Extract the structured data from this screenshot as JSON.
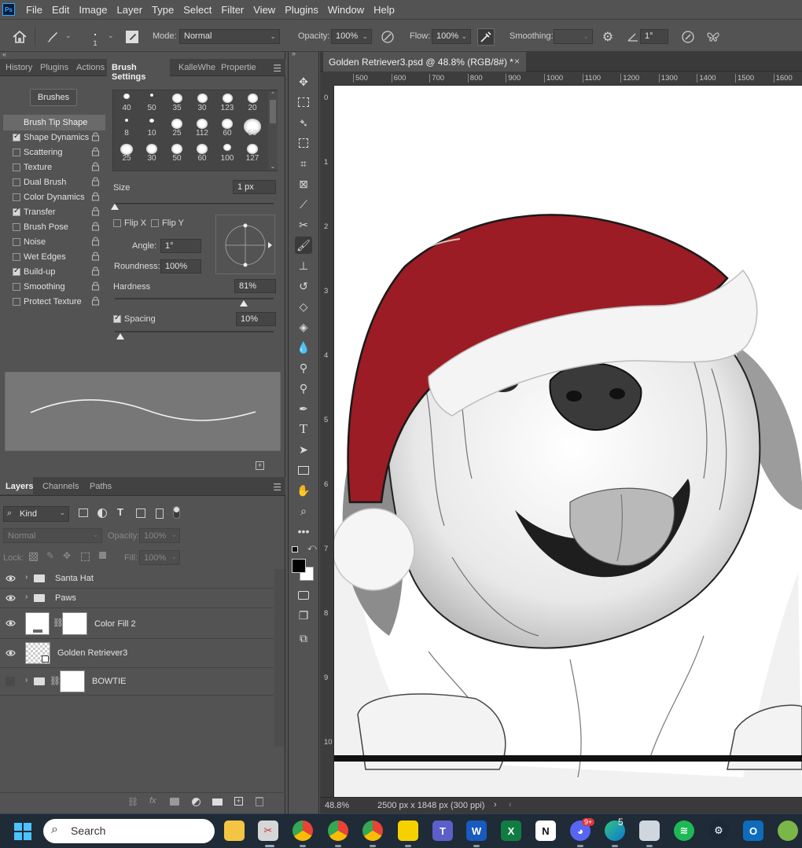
{
  "app": {
    "logo_text": "Ps"
  },
  "menu": [
    "File",
    "Edit",
    "Image",
    "Layer",
    "Type",
    "Select",
    "Filter",
    "View",
    "Plugins",
    "Window",
    "Help"
  ],
  "options": {
    "brush_size_label": "1",
    "mode_label": "Mode:",
    "mode_value": "Normal",
    "opacity_label": "Opacity:",
    "opacity_value": "100%",
    "flow_label": "Flow:",
    "flow_value": "100%",
    "smoothing_label": "Smoothing:",
    "smoothing_value": "",
    "angle_value": "1°"
  },
  "left_tabs": [
    "History",
    "Plugins",
    "Actions",
    "Brush Settings",
    "KalleWhe",
    "Propertie"
  ],
  "brush_settings": {
    "brushes_button": "Brushes",
    "tip_shape": "Brush Tip Shape",
    "items": [
      {
        "label": "Shape Dynamics",
        "checked": true
      },
      {
        "label": "Scattering",
        "checked": false
      },
      {
        "label": "Texture",
        "checked": false
      },
      {
        "label": "Dual Brush",
        "checked": false
      },
      {
        "label": "Color Dynamics",
        "checked": false
      },
      {
        "label": "Transfer",
        "checked": true
      },
      {
        "label": "Brush Pose",
        "checked": false
      },
      {
        "label": "Noise",
        "checked": false
      },
      {
        "label": "Wet Edges",
        "checked": false
      },
      {
        "label": "Build-up",
        "checked": true
      },
      {
        "label": "Smoothing",
        "checked": false
      },
      {
        "label": "Protect Texture",
        "checked": false
      }
    ],
    "presets": [
      "40",
      "50",
      "35",
      "30",
      "123",
      "20",
      "8",
      "10",
      "25",
      "112",
      "60",
      "50",
      "25",
      "30",
      "50",
      "60",
      "100",
      "127"
    ],
    "size_label": "Size",
    "size_value": "1 px",
    "size_fraction": 0.0,
    "flip_x": "Flip X",
    "flip_y": "Flip Y",
    "angle_label": "Angle:",
    "angle_value": "1°",
    "roundness_label": "Roundness:",
    "roundness_value": "100%",
    "hardness_label": "Hardness",
    "hardness_value": "81%",
    "hardness_fraction": 0.81,
    "spacing_label": "Spacing",
    "spacing_value": "10%",
    "spacing_checked": true
  },
  "layers_tabs": [
    "Layers",
    "Channels",
    "Paths"
  ],
  "layers": {
    "filter_kind": "Kind",
    "blend_mode": "Normal",
    "opacity_label": "Opacity:",
    "opacity_value": "100%",
    "lock_label": "Lock:",
    "fill_label": "Fill:",
    "fill_value": "100%",
    "rows": [
      {
        "name": "Santa Hat",
        "type": "group",
        "visible": true
      },
      {
        "name": "Paws",
        "type": "group",
        "visible": true
      },
      {
        "name": "Color Fill 2",
        "type": "fill",
        "visible": true
      },
      {
        "name": "Golden Retriever3",
        "type": "smart",
        "visible": true
      },
      {
        "name": "BOWTIE",
        "type": "group-mask",
        "visible": false
      }
    ]
  },
  "document": {
    "tab_title": "Golden Retriever3.psd @ 48.8% (RGB/8#) *",
    "close": "×",
    "ruler_h": [
      "500",
      "600",
      "700",
      "800",
      "900",
      "1000",
      "1100",
      "1200",
      "1300",
      "1400",
      "1500",
      "1600"
    ],
    "ruler_v": [
      "0",
      "1",
      "2",
      "3",
      "4",
      "5",
      "6",
      "7",
      "8",
      "9",
      "10"
    ],
    "zoom": "48.8%",
    "doc_info": "2500 px x 1848 px (300 ppi)"
  },
  "taskbar": {
    "search_placeholder": "Search",
    "discord_badge": "9+",
    "edge_badge": "5"
  },
  "colors": {
    "hat_red": "#9b1c24",
    "accent": "#31a8ff"
  }
}
